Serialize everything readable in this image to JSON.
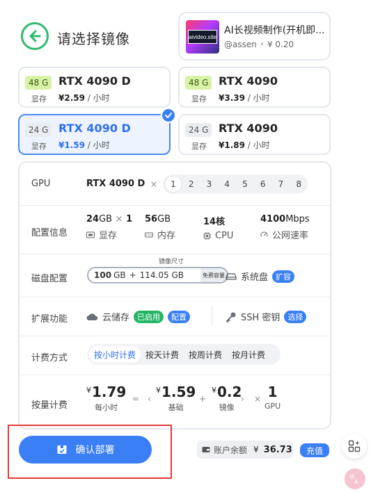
{
  "header": {
    "title": "请选择镜像"
  },
  "image": {
    "thumb_text": "aivideo.site",
    "title": "AI长视频制作(开机即...",
    "author": "@assen",
    "price": "¥ 0.20"
  },
  "gpu_options": [
    {
      "vram": "48 G",
      "vram_caption": "显存",
      "name": "RTX 4090 D",
      "price": "¥2.59",
      "unit": " / 小时"
    },
    {
      "vram": "48 G",
      "vram_caption": "显存",
      "name": "RTX 4090",
      "price": "¥3.39",
      "unit": " / 小时"
    },
    {
      "vram": "24 G",
      "vram_caption": "显存",
      "name": "RTX 4090 D",
      "price": "¥1.59",
      "unit": " / 小时"
    },
    {
      "vram": "24 G",
      "vram_caption": "显存",
      "name": "RTX 4090",
      "price": "¥1.89",
      "unit": " / 小时"
    }
  ],
  "config": {
    "gpu_row": {
      "label": "GPU",
      "name": "RTX 4090 D",
      "times": "×",
      "counts": [
        "1",
        "2",
        "3",
        "4",
        "5",
        "6",
        "7",
        "8"
      ],
      "selected_count": "1"
    },
    "spec_row": {
      "label": "配置信息",
      "vram_value": "24",
      "vram_unit": "GB",
      "vram_mult": "×",
      "vram_count": "1",
      "vram_label": "显存",
      "ram_value": "56",
      "ram_unit": "GB",
      "ram_label": "内存",
      "cpu_value": "14核",
      "cpu_label": "CPU",
      "net_value": "4100",
      "net_unit": "Mbps",
      "net_label": "公网速率"
    },
    "disk_row": {
      "label": "磁盘配置",
      "caption": "镜像尺寸",
      "base": "100",
      "base_unit": "GB",
      "plus": "+",
      "image_size": "114.05 GB",
      "free_tag": "免费容量",
      "system_disk": "系统盘",
      "expand": "扩容"
    },
    "ext_row": {
      "label": "扩展功能",
      "cloud": "云储存",
      "cloud_status": "已启用",
      "cloud_config": "配置",
      "ssh": "SSH 密钥",
      "ssh_select": "选择"
    },
    "billing_row": {
      "label": "计费方式",
      "options": [
        "按小时计费",
        "按天计费",
        "按周计费",
        "按月计费"
      ],
      "active": "按小时计费"
    },
    "pricing_row": {
      "label": "按量计费",
      "currency": "¥",
      "hourly": "1.79",
      "hourly_label": "每小时",
      "eq": "=",
      "lt": "‹",
      "base": "1.59",
      "base_label": "基础",
      "plus": "+",
      "image": "0.2",
      "image_label": "镜像",
      "gt": "›",
      "times": "×",
      "gpu": "1",
      "gpu_label": "GPU"
    }
  },
  "footer": {
    "deploy_label": "确认部署",
    "balance_label": "账户余额",
    "balance_currency": "¥",
    "balance_value": "36.73",
    "recharge_label": "充值"
  },
  "colors": {
    "accent": "#3a7ff5",
    "green": "#2fb96b",
    "highlight_frame": "#e53935"
  }
}
